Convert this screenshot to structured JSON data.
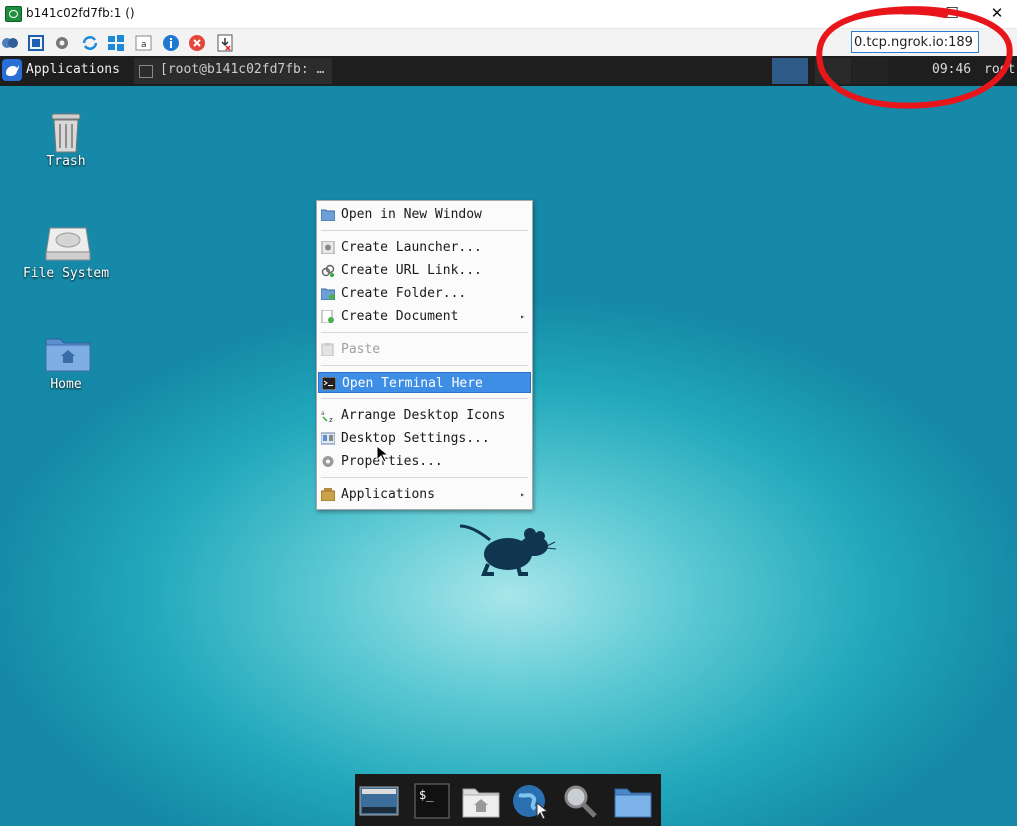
{
  "window": {
    "title": "b141c02fd7fb:1 ()",
    "minimize_label": "—",
    "maximize_label": "☐",
    "close_label": "✕"
  },
  "toolbar": {
    "buttons": [
      "options-icon",
      "fullscreen-icon",
      "settings-icon",
      "refresh-icon",
      "windows-key-icon",
      "ctrl-alt-del-icon",
      "info-icon",
      "disconnect-icon",
      "transfer-icon"
    ],
    "address": "0.tcp.ngrok.io:189"
  },
  "panel": {
    "applications_label": "Applications",
    "task_label": "[root@b141c02fd7fb: …",
    "clock": "09:46",
    "user": "root"
  },
  "desktop_icons": [
    {
      "label": "Trash"
    },
    {
      "label": "File System"
    },
    {
      "label": "Home"
    }
  ],
  "context_menu": {
    "items": [
      {
        "label": "Open in New Window",
        "icon": "folder-icon"
      },
      {
        "label": "Create Launcher...",
        "icon": "launcher-icon"
      },
      {
        "label": "Create URL Link...",
        "icon": "link-icon"
      },
      {
        "label": "Create Folder...",
        "icon": "new-folder-icon"
      },
      {
        "label": "Create Document",
        "icon": "new-document-icon",
        "submenu": true
      },
      {
        "label": "Paste",
        "icon": "paste-icon",
        "disabled": true
      },
      {
        "label": "Open Terminal Here",
        "icon": "terminal-icon",
        "highlighted": true
      },
      {
        "label": "Arrange Desktop Icons",
        "icon": "arrange-icon"
      },
      {
        "label": "Desktop Settings...",
        "icon": "desktop-settings-icon"
      },
      {
        "label": "Properties...",
        "icon": "properties-icon"
      },
      {
        "label": "Applications",
        "icon": "applications-icon",
        "submenu": true
      }
    ],
    "submenu_arrow": "▸"
  },
  "dock": {
    "items": [
      "show-desktop-icon",
      "terminal-icon",
      "home-folder-icon",
      "web-browser-icon",
      "search-icon",
      "files-icon"
    ]
  },
  "colors": {
    "highlight": "#3e8ee6",
    "annotation": "#e8151b",
    "panel": "#1e1e1e"
  }
}
